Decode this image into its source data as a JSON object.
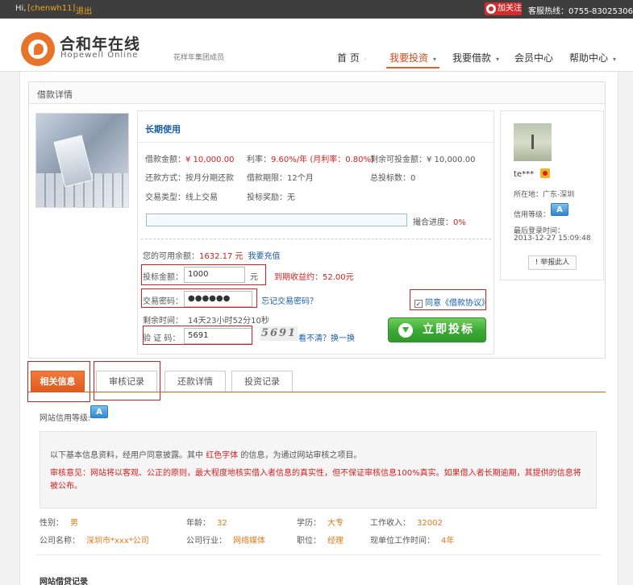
{
  "topbar": {
    "greeting": "Hi,",
    "username": "[chenwh11]",
    "logout": "退出",
    "follow": "加关注",
    "hotline": "客服热线：0755-83025306"
  },
  "header": {
    "logo_cn": "合和年在线",
    "logo_en": "Hopewell Online",
    "group_text": "花样年集团成员",
    "nav": [
      {
        "label": "首 页",
        "arrow": "·"
      },
      {
        "label": "我要投资",
        "arrow": "▾"
      },
      {
        "label": "我要借款",
        "arrow": "▾"
      },
      {
        "label": "会员中心",
        "arrow": ""
      },
      {
        "label": "帮助中心",
        "arrow": "▾"
      }
    ]
  },
  "detail": {
    "title": "借款详情",
    "loan_name": "长期使用",
    "amount_label": "借款金额：",
    "amount": "¥ 10,000.00",
    "rate_label": "利率：",
    "rate": "9.60%/年 (月利率：0.80%)",
    "remaining_label": "剩余可投金额：",
    "remaining": "¥ 10,000.00",
    "repay_label": "还款方式：",
    "repay": "按月分期还款",
    "term_label": "借款期限：",
    "term": "12个月",
    "total_bids_label": "总投标数：",
    "total_bids": "0",
    "type_label": "交易类型：",
    "type": "线上交易",
    "reward_label": "投标奖励：",
    "reward": "无",
    "progress_label": "撮合进度：",
    "progress": "0%",
    "progress_value": 0,
    "available_label": "您的可用余额：",
    "available": "1632.17 元",
    "recharge": "我要充值",
    "bid_label": "投标金额：",
    "bid_value": "1000",
    "bid_unit": "元",
    "expected_label": "到期收益约：",
    "expected": "52.00元",
    "password_label": "交易密码：",
    "password_value": "●●●●●●",
    "forgot": "忘记交易密码？",
    "agree_text": "同意《借款协议》",
    "time_label": "剩余时间：",
    "time": "14天23小时52分10秒",
    "captcha_label": "验 证 码：",
    "captcha_value": "5691",
    "captcha_image": "5691",
    "captcha_refresh": "看不清？换一换",
    "invest_button": "立即投标"
  },
  "user": {
    "name": "te***",
    "location": "所在地：广东-深圳",
    "credit_label": "信用等级：",
    "credit": "A",
    "last_login_label": "最后登录时间：",
    "last_login": "2013-12-27 15:09:48",
    "report": "! 举报此人"
  },
  "tabs": [
    {
      "label": "相关信息"
    },
    {
      "label": "审核记录"
    },
    {
      "label": "还款详情"
    },
    {
      "label": "投资记录"
    }
  ],
  "related": {
    "credit_label": "网站信用等级:",
    "credit": "A",
    "notice_pre": "以下基本信息资料，经用户同意披露。其中",
    "notice_red": "红色字体",
    "notice_post": "的信息，为通过网站审核之项目。",
    "audit_opinion": "审核意见：网站将以客观、公正的原则，最大程度地核实借入者信息的真实性，但不保证审核信息100%真实。如果借入者长期逾期，其提供的信息将被公布。",
    "gender_label": "性别：",
    "gender": "男",
    "age_label": "年龄：",
    "age": "32",
    "edu_label": "学历：",
    "edu": "大专",
    "income_label": "工作收入：",
    "income": "32002",
    "company_label": "公司名称：",
    "company": "深圳市*xxx*公司",
    "industry_label": "公司行业：",
    "industry": "网络媒体",
    "position_label": "职位：",
    "position": "经理",
    "work_years_label": "现单位工作时间：",
    "work_years": "4年",
    "loan_records_title": "网站借贷记录"
  }
}
